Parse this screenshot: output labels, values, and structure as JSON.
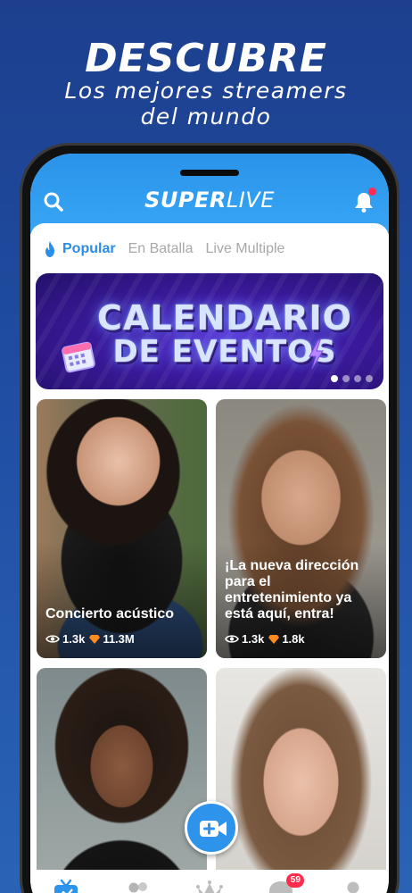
{
  "promo": {
    "title": "DESCUBRE",
    "subtitle_line1": "Los mejores streamers",
    "subtitle_line2": "del mundo"
  },
  "header": {
    "logo_super": "SUPER",
    "logo_live": "LIVE",
    "search_icon": "search-icon",
    "bell_icon": "bell-icon"
  },
  "tabs": [
    {
      "label": "Popular",
      "active": true,
      "icon": "flame-icon"
    },
    {
      "label": "En Batalla",
      "active": false
    },
    {
      "label": "Live Multiple",
      "active": false
    }
  ],
  "banner": {
    "line1": "CALENDARIO",
    "line2": "DE EVENTOS",
    "slide_count": 4,
    "active_slide": 1
  },
  "cards": [
    {
      "title": "Concierto acústico",
      "viewers": "1.3k",
      "gems": "11.3M"
    },
    {
      "title": "¡La nueva dirección para el entretenimiento ya está aquí, entra!",
      "viewers": "1.3k",
      "gems": "1.8k"
    },
    {
      "title": "",
      "viewers": "",
      "gems": ""
    },
    {
      "title": "",
      "viewers": "",
      "gems": ""
    }
  ],
  "fab": {
    "icon": "video-plus-icon"
  },
  "bottom_nav": [
    {
      "icon": "live-tv-icon",
      "active": true
    },
    {
      "icon": "users-icon",
      "active": false
    },
    {
      "icon": "crown-icon",
      "active": false
    },
    {
      "icon": "chat-icon",
      "active": false,
      "badge": "59"
    },
    {
      "icon": "profile-icon",
      "active": false
    }
  ],
  "colors": {
    "brand_blue": "#2e93ea",
    "accent_red": "#ff2c4b",
    "gem_orange": "#ff8a1e"
  }
}
